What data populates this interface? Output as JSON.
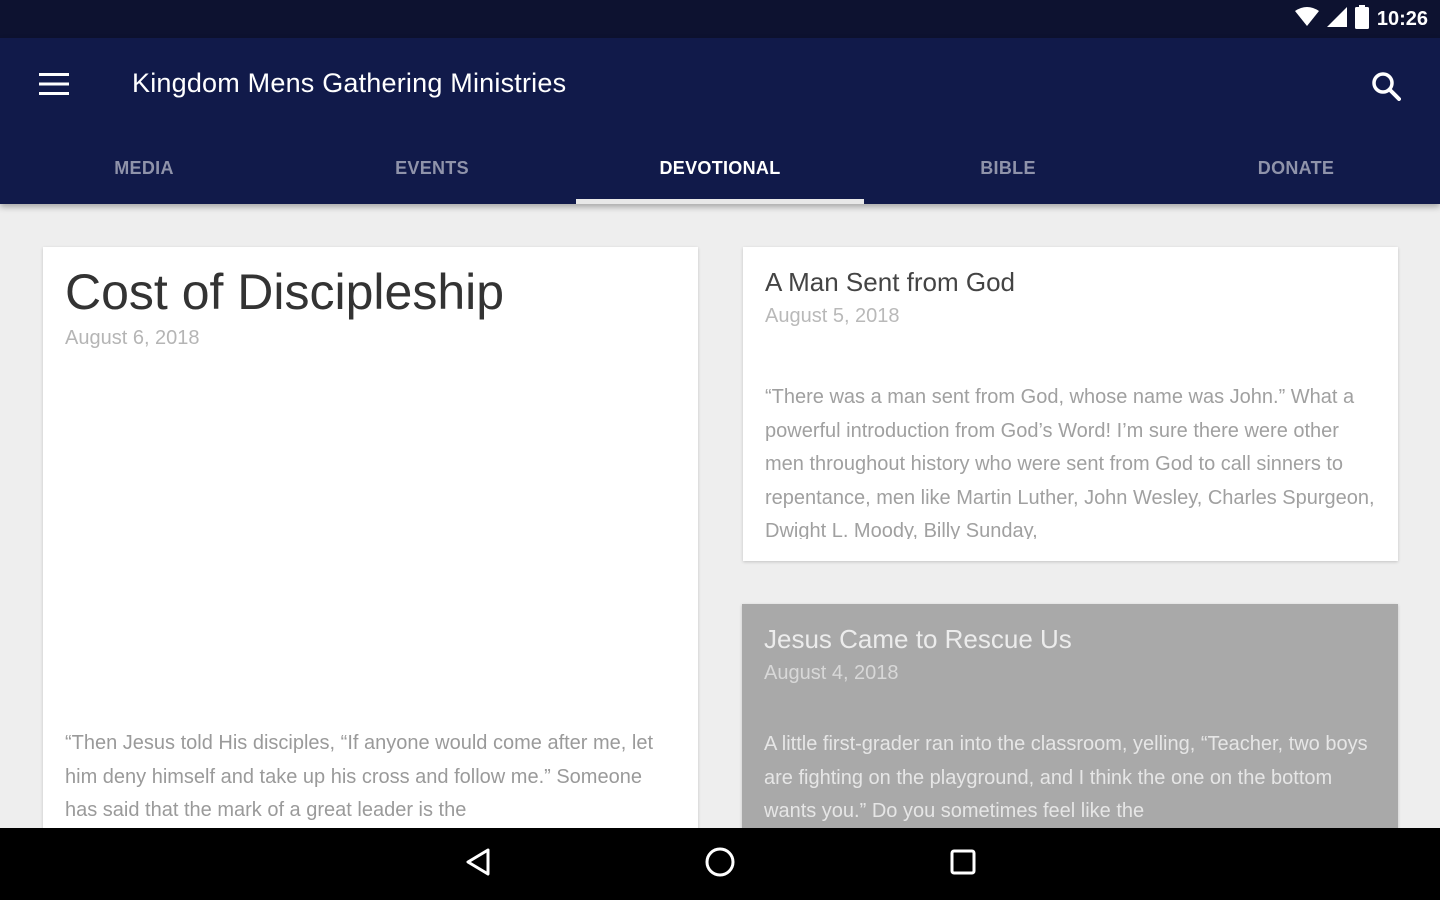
{
  "status_bar": {
    "time": "10:26"
  },
  "app_bar": {
    "title": "Kingdom Mens Gathering Ministries",
    "color": "#111a4a"
  },
  "tabs": [
    {
      "label": "MEDIA"
    },
    {
      "label": "EVENTS"
    },
    {
      "label": "DEVOTIONAL",
      "active": true
    },
    {
      "label": "BIBLE"
    },
    {
      "label": "DONATE"
    }
  ],
  "devotionals": [
    {
      "title": "Cost of Discipleship",
      "date": "August 6, 2018",
      "excerpt": "“Then Jesus told His disciples, “If anyone would come after me, let him deny himself and take up his cross and follow me.” Someone has said that the mark of a great leader is the"
    },
    {
      "title": "A Man Sent from God",
      "date": "August 5, 2018",
      "excerpt": "“There was a man sent from God, whose name was John.” What a powerful introduction from God’s Word! I’m sure there were other men throughout history who were sent from God to call sinners to repentance, men like Martin Luther, John Wesley, Charles Spurgeon, Dwight L. Moody, Billy Sunday,"
    },
    {
      "title": "Jesus Came to Rescue Us",
      "date": "August 4, 2018",
      "excerpt": "A little first-grader ran into the classroom, yelling, “Teacher, two boys are fighting on the playground, and I think the one on the bottom wants you.” Do you sometimes feel like the"
    }
  ]
}
